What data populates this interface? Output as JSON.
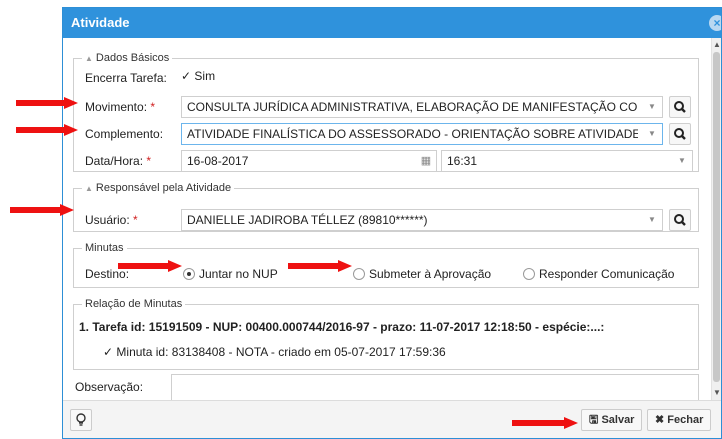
{
  "window": {
    "title": "Atividade",
    "close_icon": "×"
  },
  "dados_basicos": {
    "legend": "Dados Básicos",
    "encerra_label": "Encerra Tarefa:",
    "encerra_value": "Sim",
    "movimento_label": "Movimento:",
    "movimento_value": "CONSULTA JURÍDICA ADMINISTRATIVA, ELABORAÇÃO DE MANIFESTAÇÃO COM",
    "complemento_label": "Complemento:",
    "complemento_value": "ATIVIDADE FINALÍSTICA DO ASSESSORADO - ORIENTAÇÃO SOBRE ATIVIDADE",
    "datahora_label": "Data/Hora:",
    "date_value": "16-08-2017",
    "time_value": "16:31",
    "required_mark": "*"
  },
  "responsavel": {
    "legend": "Responsável pela Atividade",
    "usuario_label": "Usuário:",
    "usuario_value": "DANIELLE JADIROBA TÉLLEZ (89810******)"
  },
  "minutas": {
    "legend": "Minutas",
    "destino_label": "Destino:",
    "options": [
      "Juntar no NUP",
      "Submeter à Aprovação",
      "Responder Comunicação"
    ],
    "selected": "Juntar no NUP"
  },
  "relacao": {
    "legend": "Relação de Minutas",
    "item_title": "1. Tarefa id: 15191509 - NUP: 00400.000744/2016-97 - prazo: 11-07-2017 12:18:50 - espécie:...:",
    "item_minuta": "Minuta id: 83138408 - NOTA - criado em 05-07-2017 17:59:36"
  },
  "observacao_label": "Observação:",
  "footer": {
    "save_label": "Salvar",
    "close_label": "Fechar"
  },
  "colors": {
    "titlebar": "#2f92dc",
    "annotation_arrow": "#ee1111"
  }
}
